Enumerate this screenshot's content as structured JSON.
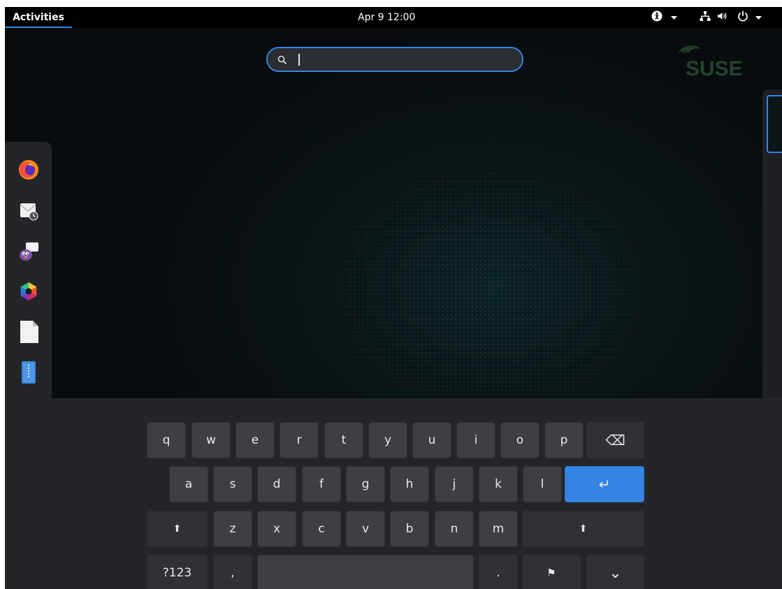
{
  "topbar": {
    "activities_label": "Activities",
    "clock": "Apr 9  12:00",
    "tray_icons": [
      "accessibility-icon",
      "dropdown-arrow-icon",
      "network-icon",
      "volume-icon",
      "power-icon",
      "dropdown-arrow-icon"
    ]
  },
  "search": {
    "value": "",
    "placeholder": ""
  },
  "brand_logo_text": "SUSE",
  "dash": {
    "apps": [
      {
        "name": "firefox-icon"
      },
      {
        "name": "mail-clock-icon"
      },
      {
        "name": "pidgin-chat-icon"
      },
      {
        "name": "color-wheel-icon"
      },
      {
        "name": "document-icon"
      },
      {
        "name": "archive-icon"
      },
      {
        "name": "image-folder-icon"
      },
      {
        "name": "lifebuoy-help-icon"
      },
      {
        "name": "app-grid-icon"
      }
    ]
  },
  "keyboard": {
    "row1": [
      "q",
      "w",
      "e",
      "r",
      "t",
      "y",
      "u",
      "i",
      "o",
      "p"
    ],
    "backspace": "⌫",
    "row2": [
      "a",
      "s",
      "d",
      "f",
      "g",
      "h",
      "j",
      "k",
      "l"
    ],
    "enter": "↵",
    "row3": [
      "z",
      "x",
      "c",
      "v",
      "b",
      "n",
      "m"
    ],
    "shift": "⬆",
    "row4": {
      "numbers": "?123",
      "comma": ",",
      "period": ".",
      "flag": "⚑",
      "hide": "⌄"
    }
  },
  "colors": {
    "accent": "#3584e4",
    "topbar": "#000000",
    "panel": "#232528",
    "key": "#3d3f43"
  }
}
